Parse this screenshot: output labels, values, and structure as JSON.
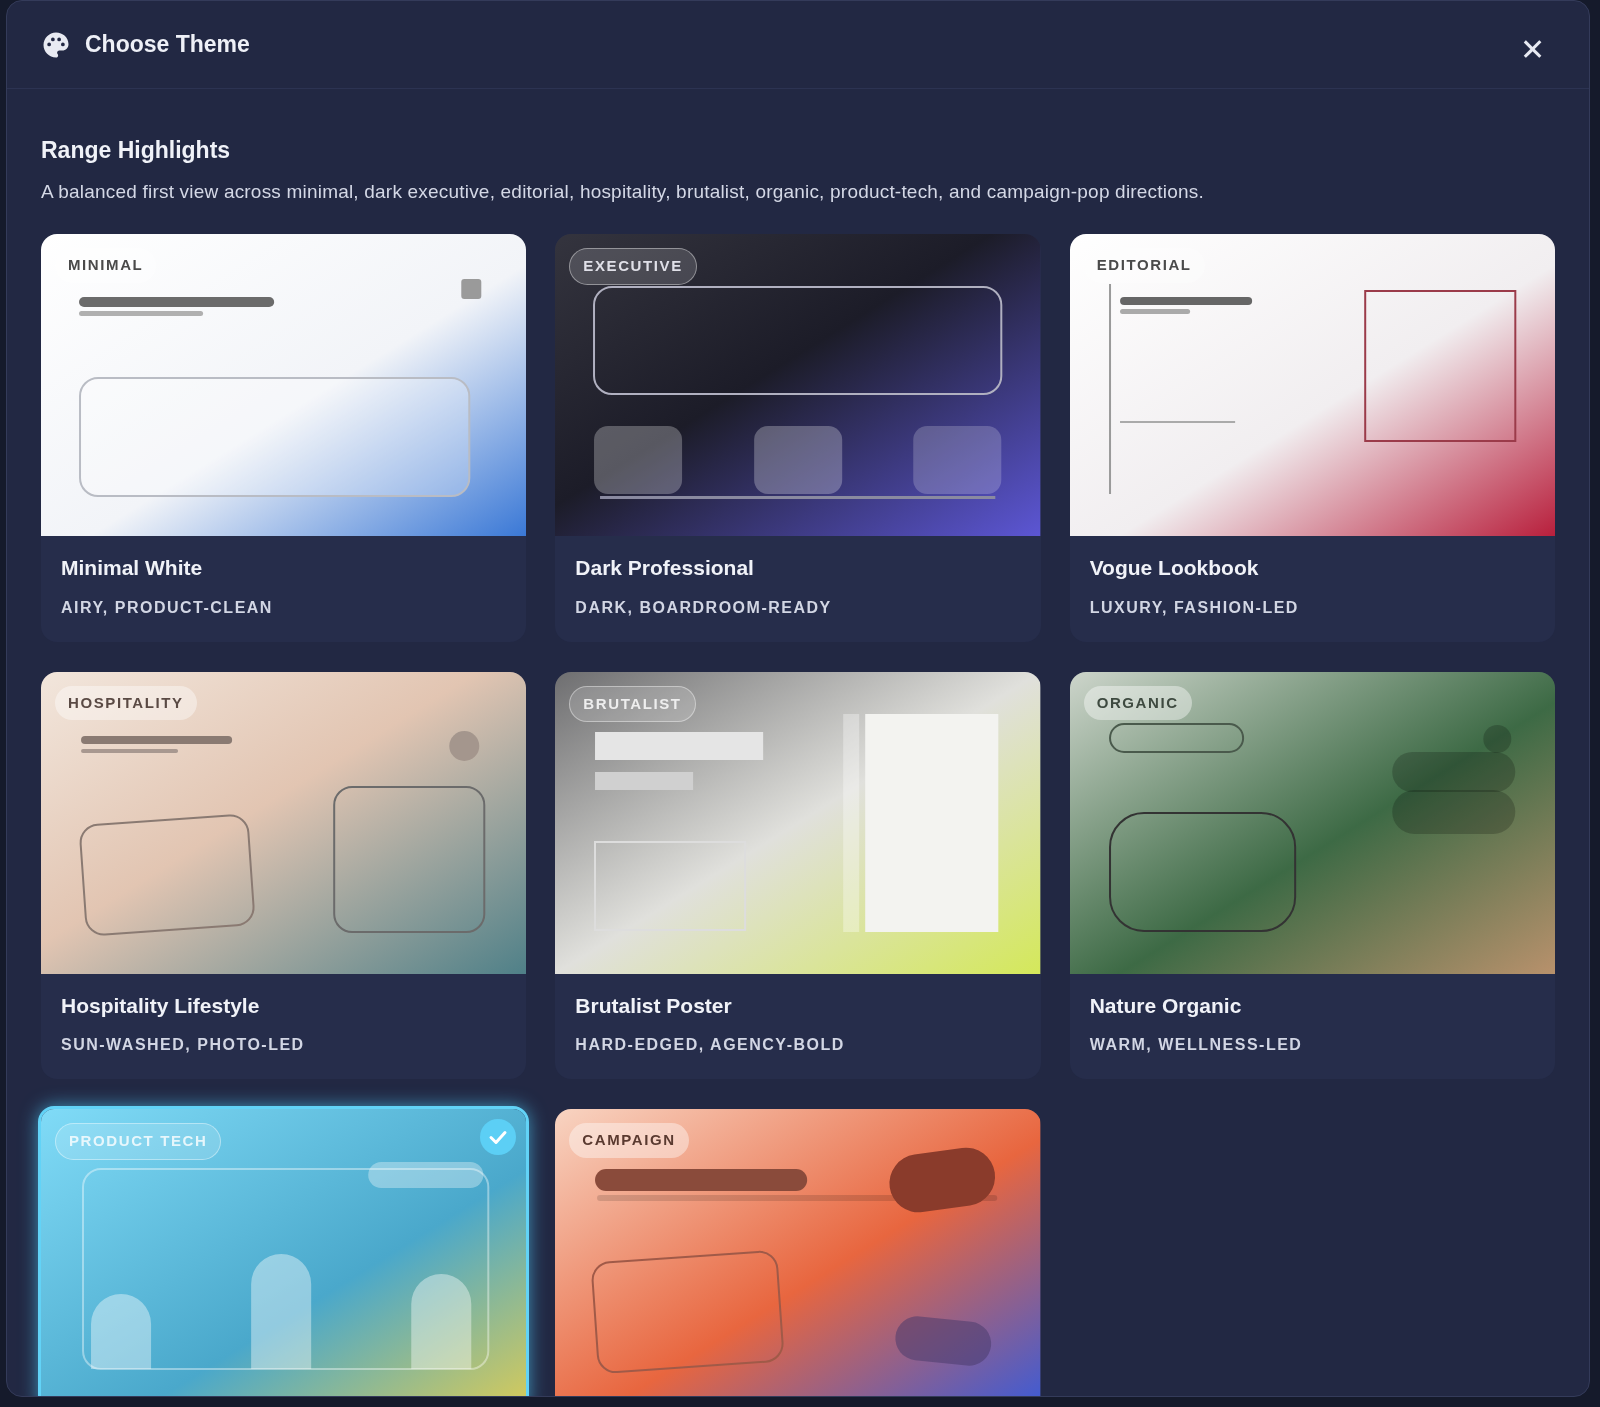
{
  "dialog": {
    "title": "Choose Theme",
    "close": "✕"
  },
  "section": {
    "title": "Range Highlights",
    "description": "A balanced first view across minimal, dark executive, editorial, hospitality, brutalist, organic, product-tech, and campaign-pop directions."
  },
  "themes": [
    {
      "kind": "minimal",
      "tag": "MINIMAL",
      "name": "Minimal White",
      "traits": "AIRY, PRODUCT-CLEAN",
      "selected": false
    },
    {
      "kind": "executive",
      "tag": "EXECUTIVE",
      "name": "Dark Professional",
      "traits": "DARK, BOARDROOM-READY",
      "selected": false
    },
    {
      "kind": "editorial",
      "tag": "EDITORIAL",
      "name": "Vogue Lookbook",
      "traits": "LUXURY, FASHION-LED",
      "selected": false
    },
    {
      "kind": "hospitality",
      "tag": "HOSPITALITY",
      "name": "Hospitality Lifestyle",
      "traits": "SUN-WASHED, PHOTO-LED",
      "selected": false
    },
    {
      "kind": "brutalist",
      "tag": "BRUTALIST",
      "name": "Brutalist Poster",
      "traits": "HARD-EDGED, AGENCY-BOLD",
      "selected": false
    },
    {
      "kind": "organic",
      "tag": "ORGANIC",
      "name": "Nature Organic",
      "traits": "WARM, WELLNESS-LED",
      "selected": false
    },
    {
      "kind": "producttech",
      "tag": "PRODUCT TECH",
      "selected": true
    },
    {
      "kind": "campaign",
      "tag": "CAMPAIGN",
      "selected": false
    }
  ]
}
